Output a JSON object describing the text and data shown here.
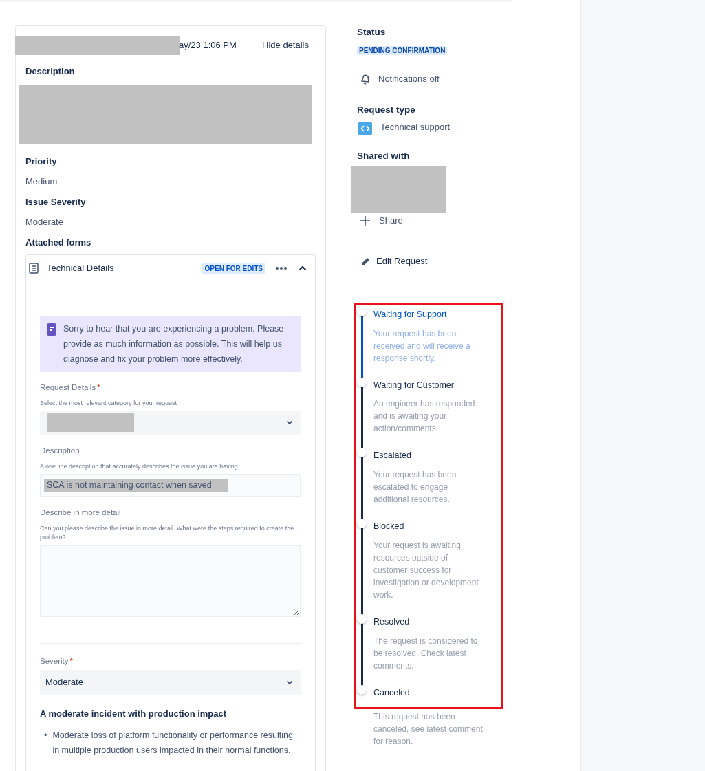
{
  "header": {
    "timestamp": "ay/23 1:06 PM",
    "toggle": "Hide details"
  },
  "details": [
    {
      "label": "Description",
      "kind": "redacted"
    },
    {
      "label": "Priority",
      "kind": "text",
      "value": "Medium"
    },
    {
      "label": "Issue Severity",
      "kind": "text",
      "value": "Moderate"
    }
  ],
  "attached_forms": {
    "label": "Attached forms",
    "form": {
      "title": "Technical Details",
      "badge": "OPEN FOR EDITS",
      "expanded": true,
      "notice": "Sorry to hear that you are experiencing a problem.  Please provide as much information as possible. This will help us diagnose and fix your problem more effectively.",
      "fields": [
        {
          "kind": "select",
          "label": "Request Details",
          "required_mark": "*",
          "help": "Select the most relevant category for your request",
          "redacted": true
        },
        {
          "kind": "text",
          "label": "Description",
          "help": "A one line description that accurately describes the issue you are having",
          "value": "SCA is not maintaining contact when saved",
          "redacted": true
        },
        {
          "kind": "textarea",
          "label": "Describe in more detail",
          "help": "Can you please describe the issue in more detail. What were the steps required to create the problem?"
        },
        {
          "kind": "divider"
        },
        {
          "kind": "select",
          "label": "Severity",
          "required_mark": "*",
          "value": "Moderate"
        }
      ],
      "severity_info": {
        "heading": "A moderate incident with production impact",
        "bullets": [
          {
            "marker": "•",
            "text": "Moderate loss of platform functionality or performance resulting in multiple production users impacted in their normal functions."
          }
        ]
      }
    }
  },
  "sidebar": {
    "status_label": "Status",
    "status": "PENDING CONFIRMATION",
    "notifications": "Notifications off",
    "request_type_label": "Request type",
    "request_type": "Technical support",
    "shared_label": "Shared with",
    "share": "Share",
    "edit": "Edit Request"
  },
  "timeline": [
    {
      "title": "Waiting for Support",
      "description": "Your request has been received and will receive a response shortly.",
      "selected": true
    },
    {
      "title": "Waiting for Customer",
      "description": "An engineer has responded and is awaiting your action/comments.",
      "selected": false
    },
    {
      "title": "Escalated",
      "description": "Your request has been escalated to engage additional resources.",
      "selected": false
    },
    {
      "title": "Blocked",
      "description": "Your request is awaiting resources outside of customer success for investigation or development work.",
      "selected": false
    },
    {
      "title": "Resolved",
      "description": "The request is considered to be resolved. Check latest comments.",
      "selected": false
    },
    {
      "title": "Canceled",
      "description": "This request has been canceled, see latest comment for reason.",
      "selected": false
    }
  ]
}
